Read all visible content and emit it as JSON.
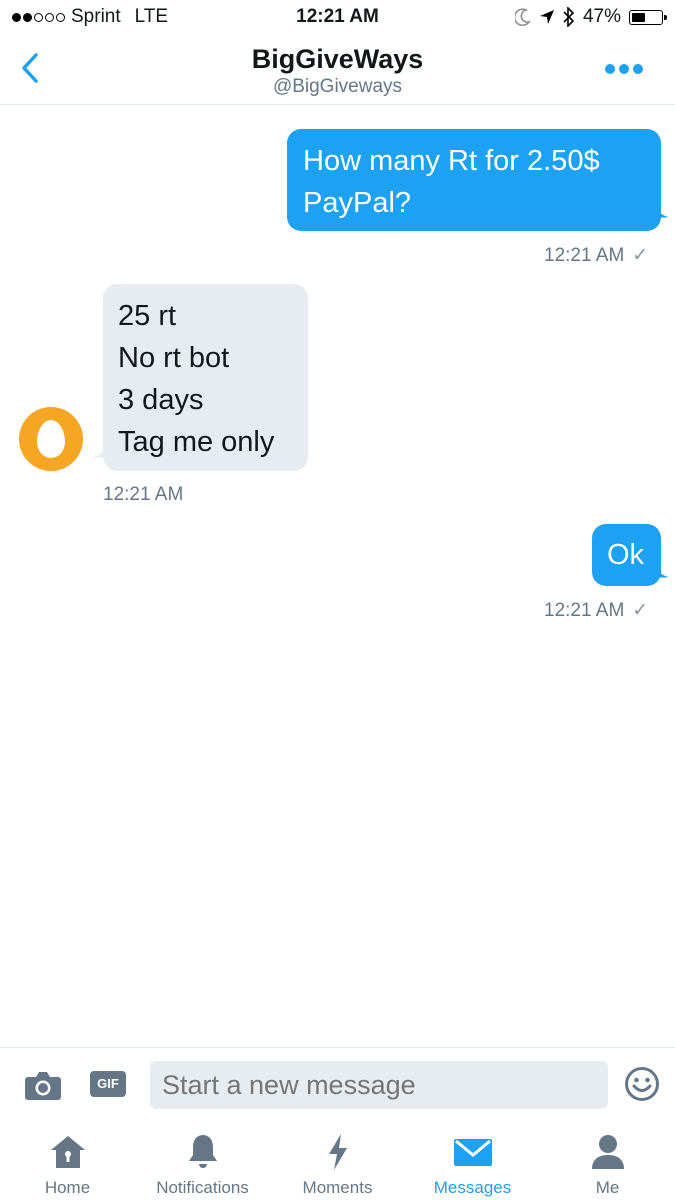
{
  "status_bar": {
    "carrier": "Sprint",
    "network": "LTE",
    "time": "12:21 AM",
    "battery": "47%",
    "battery_level": 0.47,
    "signal_bars": 2
  },
  "header": {
    "title": "BigGiveWays",
    "handle": "@BigGiveways"
  },
  "messages": [
    {
      "direction": "out",
      "text": "How many Rt for 2.50$\nPayPal?",
      "time": "12:21 AM",
      "read": true
    },
    {
      "direction": "in",
      "text": "25 rt\nNo rt bot\n3 days\nTag me only",
      "time": "12:21 AM"
    },
    {
      "direction": "out",
      "text": "Ok",
      "time": "12:21 AM",
      "read": true
    }
  ],
  "composer": {
    "placeholder": "Start a new message",
    "gif_label": "GIF"
  },
  "tabs": [
    {
      "label": "Home",
      "icon": "home-icon",
      "active": false
    },
    {
      "label": "Notifications",
      "icon": "bell-icon",
      "active": false
    },
    {
      "label": "Moments",
      "icon": "lightning-icon",
      "active": false
    },
    {
      "label": "Messages",
      "icon": "envelope-icon",
      "active": true
    },
    {
      "label": "Me",
      "icon": "person-icon",
      "active": false
    }
  ],
  "colors": {
    "accent": "#1da1f2",
    "incoming_bubble": "#e6ecf0",
    "avatar": "#f5a623",
    "muted": "#657786"
  }
}
